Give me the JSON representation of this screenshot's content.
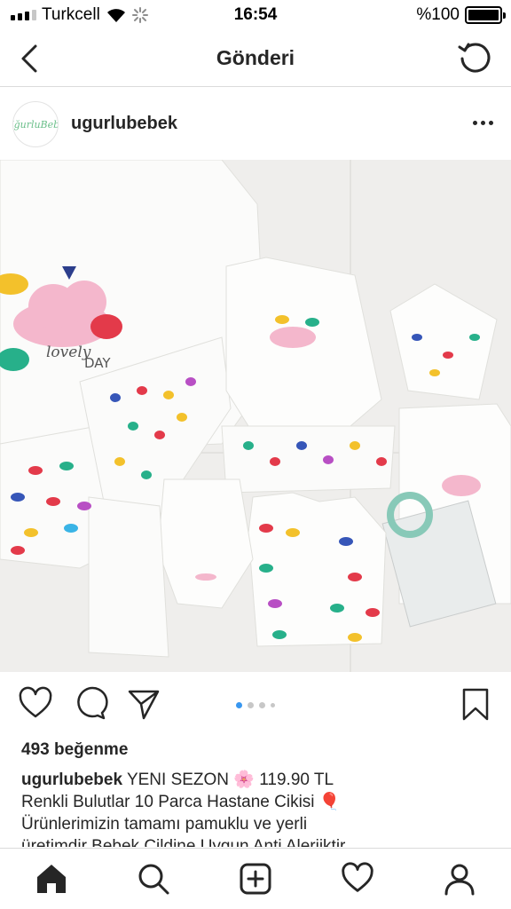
{
  "status_bar": {
    "carrier": "Turkcell",
    "time": "16:54",
    "battery": "%100"
  },
  "nav": {
    "title": "Gönderi"
  },
  "post": {
    "username": "ugurlubebek",
    "avatar_text": "UğurluBebe",
    "likes": "493 beğenme",
    "caption": {
      "username": "ugurlubebek",
      "line1": "YENI SEZON 🌸 119.90 TL",
      "line2": "Renkli Bulutlar 10 Parca  Hastane Cikisi 🎈",
      "line3": "Ürünlerimizin tamamı pamuklu ve yerli",
      "line4": "üretimdir Bebek Cildine Uygun Anti Alerjiktir"
    },
    "photo_text": {
      "lovely": "lovely",
      "day": "DAY"
    },
    "carousel": {
      "count": 4,
      "active": 0
    }
  },
  "colors": {
    "accent_blue": "#3897f0",
    "text": "#262626",
    "divider": "#dbdbdb"
  },
  "icons": {
    "back": "chevron-left-icon",
    "refresh": "refresh-icon",
    "more": "more-horizontal-icon",
    "like": "heart-icon",
    "comment": "comment-icon",
    "share": "share-icon",
    "save": "bookmark-icon",
    "home": "home-icon",
    "search": "search-icon",
    "new_post": "add-post-icon",
    "activity": "heart-icon",
    "profile": "profile-icon"
  }
}
